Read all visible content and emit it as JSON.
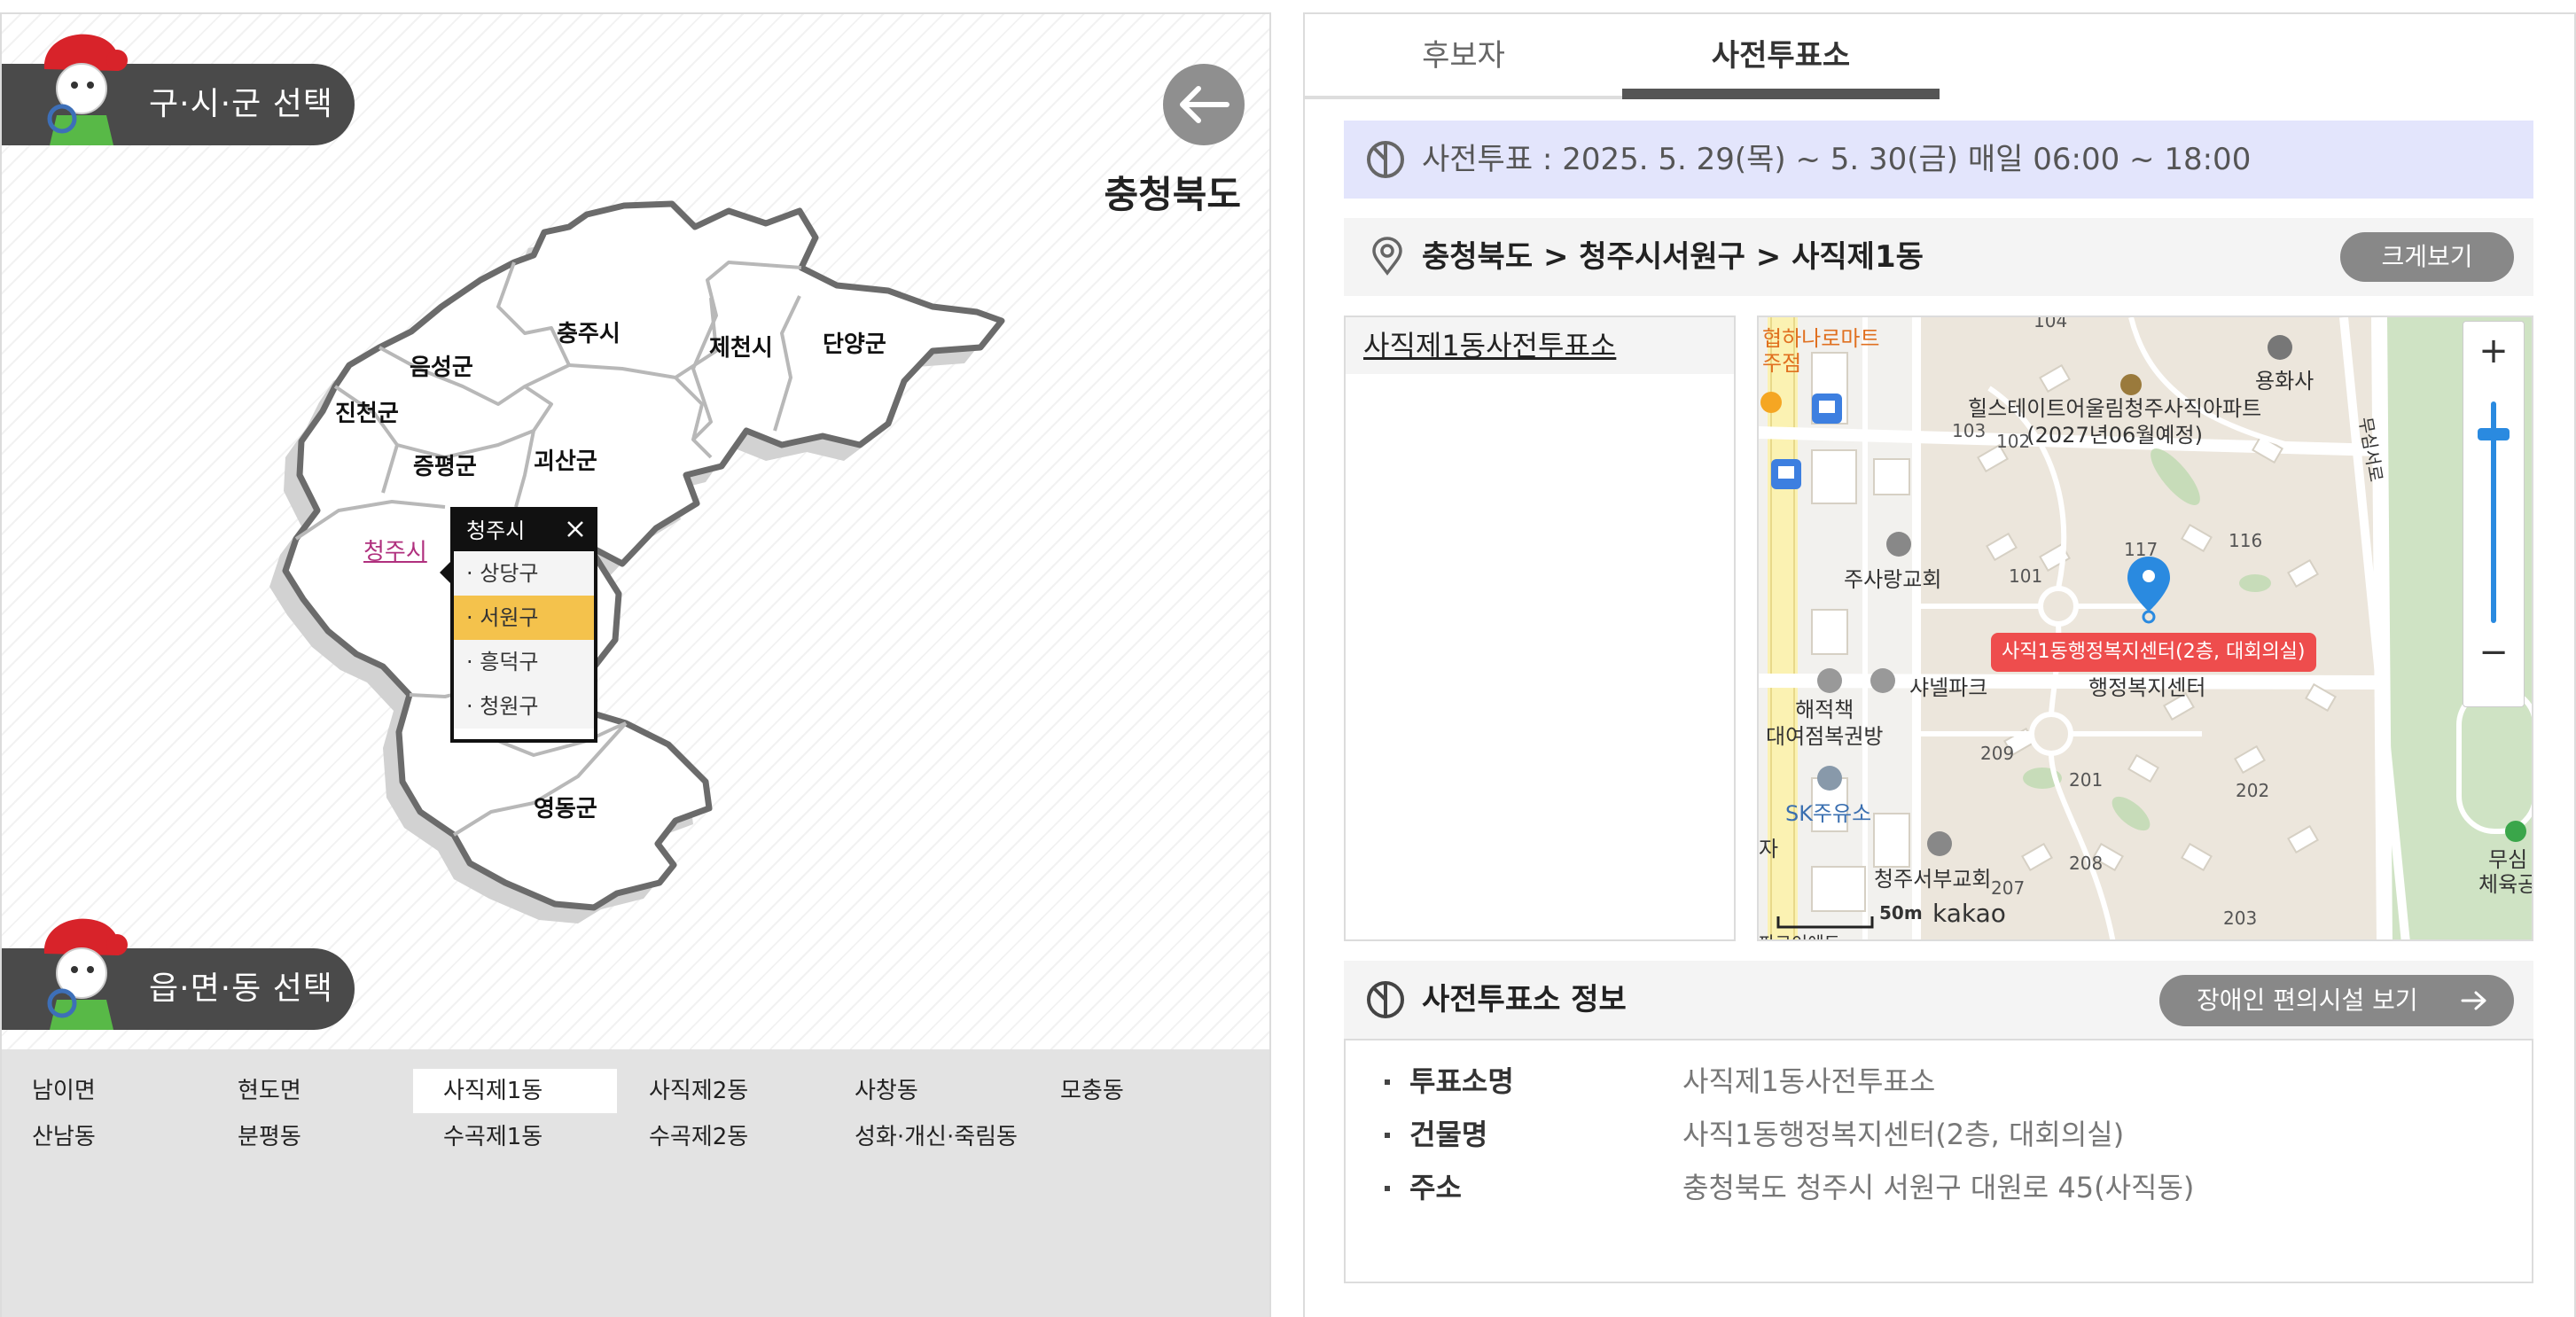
{
  "left_panel": {
    "district_select_label": "구·시·군 선택",
    "dong_select_label": "읍·면·동 선택",
    "province_name": "충청북도",
    "back_icon": "arrow-left-icon",
    "regions": {
      "chungju": "충주시",
      "jecheon": "제천시",
      "danyang": "단양군",
      "eumseong": "음성군",
      "jincheon": "진천군",
      "jeungpyeong": "증평군",
      "goesan": "괴산군",
      "cheongju": "청주시",
      "yeongdong": "영동군"
    },
    "popup": {
      "title": "청주시",
      "items": [
        "· 상당구",
        "· 서원구",
        "· 흥덕구",
        "· 청원구"
      ],
      "selected_index": 1
    },
    "dong_list": [
      "남이면",
      "현도면",
      "사직제1동",
      "사직제2동",
      "사창동",
      "모충동",
      "산남동",
      "분평동",
      "수곡제1동",
      "수곡제2동",
      "성화·개신·죽림동"
    ],
    "dong_selected_index": 2
  },
  "right_panel": {
    "tabs": [
      "후보자",
      "사전투표소"
    ],
    "active_tab": 1,
    "period_text": "사전투표 : 2025. 5. 29(목) ~ 5. 30(금) 매일 06:00 ~ 18:00",
    "location_path": "충청북도 > 청주시서원구 > 사직제1동",
    "big_view_button": "크게보기",
    "station_list": [
      "사직제1동사전투표소"
    ],
    "map": {
      "pin_label": "사직1동행정복지센터(2층, 대회의실)",
      "labels": {
        "mart": "협하나로마트\n주점",
        "apt": "힐스테이트어울림청주사직아파트\n(2027년06월예정)",
        "temple": "용화사",
        "church1": "주사랑교회",
        "shanel": "샤넬파크",
        "welfare": "행정복지센터",
        "bookstore": "해적책\n대여점복권방",
        "gas": "SK주유소",
        "church2": "청주서부교회",
        "road": "무심서로",
        "gym": "무심\n체육공",
        "ja": "자",
        "bottom_cut": "파크이에도"
      },
      "building_numbers": [
        "104",
        "103",
        "102",
        "101",
        "117",
        "116",
        "209",
        "201",
        "202",
        "208",
        "207",
        "203"
      ],
      "scale": "50m",
      "brand": "kakao",
      "zoom_in": "+",
      "zoom_out": "−"
    },
    "info": {
      "title": "사전투표소 정보",
      "accessibility_button": "장애인 편의시설 보기",
      "rows": [
        {
          "key": "투표소명",
          "value": "사직제1동사전투표소"
        },
        {
          "key": "건물명",
          "value": "사직1동행정복지센터(2층, 대회의실)"
        },
        {
          "key": "주소",
          "value": "충청북도 청주시 서원구 대원로 45(사직동)"
        }
      ]
    }
  },
  "colors": {
    "pill": "#4a4a4a",
    "popup_selected": "#f4c24c",
    "period_bg": "#e3e5fc",
    "pin": "#2a8ae0",
    "pin_label": "#ee4d4d",
    "link_region": "#b0307e"
  }
}
